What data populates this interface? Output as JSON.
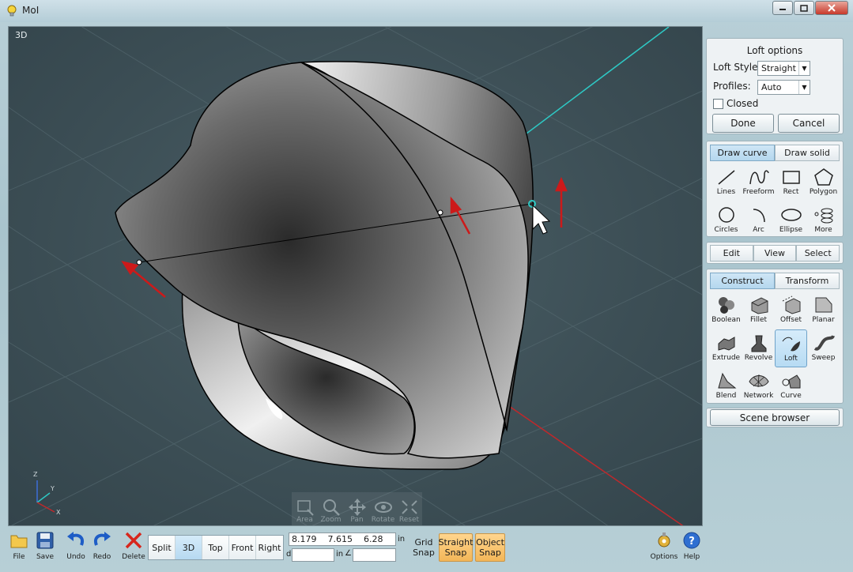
{
  "window": {
    "title": "MoI",
    "icon": "lightbulb-icon",
    "controls": [
      "minimize-icon",
      "maximize-icon",
      "close-icon"
    ]
  },
  "viewport": {
    "label": "3D",
    "axis_labels": {
      "z": "Z",
      "y": "Y",
      "x": "X"
    },
    "nav_tools": [
      {
        "name": "area",
        "label": "Area",
        "icon": "area-zoom-icon"
      },
      {
        "name": "zoom",
        "label": "Zoom",
        "icon": "magnifier-icon"
      },
      {
        "name": "pan",
        "label": "Pan",
        "icon": "pan-arrows-icon"
      },
      {
        "name": "rotate",
        "label": "Rotate",
        "icon": "rotate-icon"
      },
      {
        "name": "reset",
        "label": "Reset",
        "icon": "reset-icon"
      }
    ],
    "colors": {
      "background": "#3f5259",
      "x_axis": "#c0282b",
      "y_axis": "#2ec8c4"
    }
  },
  "loft_options": {
    "title": "Loft options",
    "style_label": "Loft Style:",
    "style_value": "Straight",
    "profiles_label": "Profiles:",
    "profiles_value": "Auto",
    "closed_label": "Closed",
    "closed_checked": false,
    "done_label": "Done",
    "cancel_label": "Cancel"
  },
  "draw_tabs": {
    "curve": "Draw curve",
    "solid": "Draw solid",
    "active": "curve"
  },
  "draw_tools": [
    {
      "label": "Lines",
      "icon": "line-icon"
    },
    {
      "label": "Freeform",
      "icon": "freeform-icon"
    },
    {
      "label": "Rect",
      "icon": "rectangle-icon"
    },
    {
      "label": "Polygon",
      "icon": "polygon-icon"
    },
    {
      "label": "Circles",
      "icon": "circle-icon"
    },
    {
      "label": "Arc",
      "icon": "arc-icon"
    },
    {
      "label": "Ellipse",
      "icon": "ellipse-icon"
    },
    {
      "label": "More",
      "icon": "more-curves-icon"
    }
  ],
  "edit_tabs": [
    "Edit",
    "View",
    "Select"
  ],
  "construct_tabs": {
    "construct": "Construct",
    "transform": "Transform",
    "active": "construct"
  },
  "construct_tools": [
    {
      "label": "Boolean",
      "icon": "boolean-icon"
    },
    {
      "label": "Fillet",
      "icon": "fillet-icon"
    },
    {
      "label": "Offset",
      "icon": "offset-icon"
    },
    {
      "label": "Planar",
      "icon": "planar-icon"
    },
    {
      "label": "Extrude",
      "icon": "extrude-icon"
    },
    {
      "label": "Revolve",
      "icon": "revolve-icon"
    },
    {
      "label": "Loft",
      "icon": "loft-icon",
      "active": true
    },
    {
      "label": "Sweep",
      "icon": "sweep-icon"
    },
    {
      "label": "Blend",
      "icon": "blend-icon"
    },
    {
      "label": "Network",
      "icon": "network-icon"
    },
    {
      "label": "Curve",
      "icon": "curve-icon"
    }
  ],
  "scene_browser_label": "Scene browser",
  "bottom": {
    "file": "File",
    "save": "Save",
    "undo": "Undo",
    "redo": "Redo",
    "delete": "Delete",
    "views": [
      "Split",
      "3D",
      "Top",
      "Front",
      "Right"
    ],
    "active_view": "3D",
    "coords": {
      "x": "8.179",
      "y": "7.615",
      "z": "6.28"
    },
    "unit": "in",
    "d_label": "d",
    "d_unit": "in",
    "angle_glyph": "∠",
    "grid_snap": {
      "line1": "Grid",
      "line2": "Snap",
      "on": false
    },
    "straight_snap": {
      "line1": "Straight",
      "line2": "Snap",
      "on": true
    },
    "object_snap": {
      "line1": "Object",
      "line2": "Snap",
      "on": true
    },
    "options": "Options",
    "help": "Help"
  }
}
